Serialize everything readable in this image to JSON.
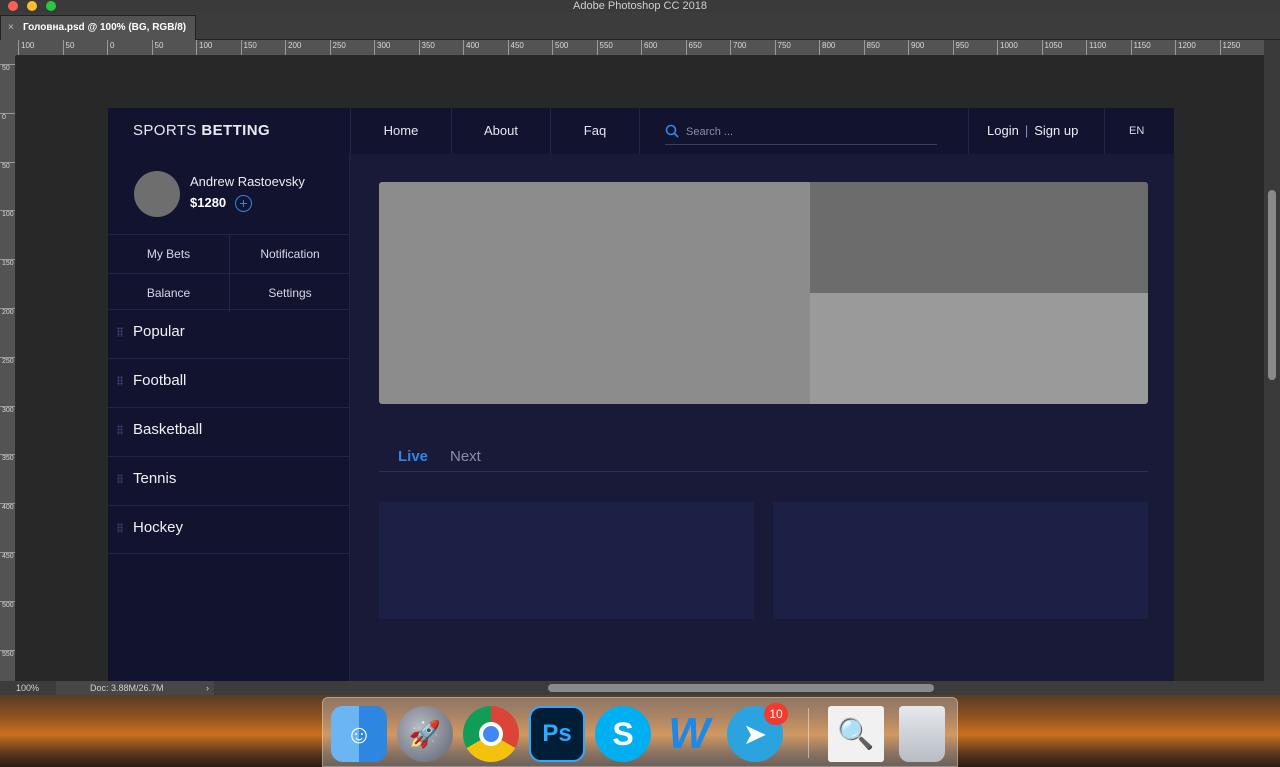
{
  "app": {
    "window_title": "Adobe Photoshop CC 2018",
    "doc_tab": "Головна.psd @ 100% (BG, RGB/8)",
    "close_glyph": "×"
  },
  "rulers": {
    "top_labels": [
      "100",
      "50",
      "0",
      "50",
      "100",
      "150",
      "200",
      "250",
      "300",
      "350",
      "400",
      "450",
      "500",
      "550",
      "600",
      "650",
      "700",
      "750",
      "800",
      "850",
      "900",
      "950",
      "1000",
      "1050",
      "1100",
      "1150",
      "1200",
      "1250"
    ],
    "left_labels": [
      "50",
      "0",
      "50",
      "100",
      "150",
      "200",
      "250",
      "300",
      "350",
      "400",
      "450",
      "500",
      "550",
      "600"
    ]
  },
  "status": {
    "zoom": "100%",
    "doc_size": "Doc: 3.88M/26.7M",
    "arrow": "›"
  },
  "site": {
    "brand_light": "SPORTS ",
    "brand_bold": "BETTING",
    "nav": [
      "Home",
      "About",
      "Faq"
    ],
    "search_placeholder": "Search ...",
    "login": "Login",
    "auth_sep": "|",
    "signup": "Sign up",
    "lang": "EN",
    "user": {
      "name": "Andrew Rastoevsky",
      "balance": "$1280",
      "add_glyph": "+"
    },
    "account_links": [
      "My Bets",
      "Notification",
      "Balance",
      "Settings"
    ],
    "sports": [
      "Popular",
      "Football",
      "Basketball",
      "Tennis",
      "Hockey"
    ],
    "tabs": {
      "live": "Live",
      "next": "Next"
    }
  },
  "dock": {
    "ps_label": "Ps",
    "skype_label": "S",
    "w_label": "W",
    "telegram_badge": "10",
    "preview_glyph": "🔍",
    "rocket_glyph": "🚀",
    "telegram_glyph": "➤",
    "finder_glyph": "☺"
  },
  "colors": {
    "accent": "#2f86e6",
    "doc_bg": "#181a38",
    "sidebar_bg": "#12132f"
  }
}
